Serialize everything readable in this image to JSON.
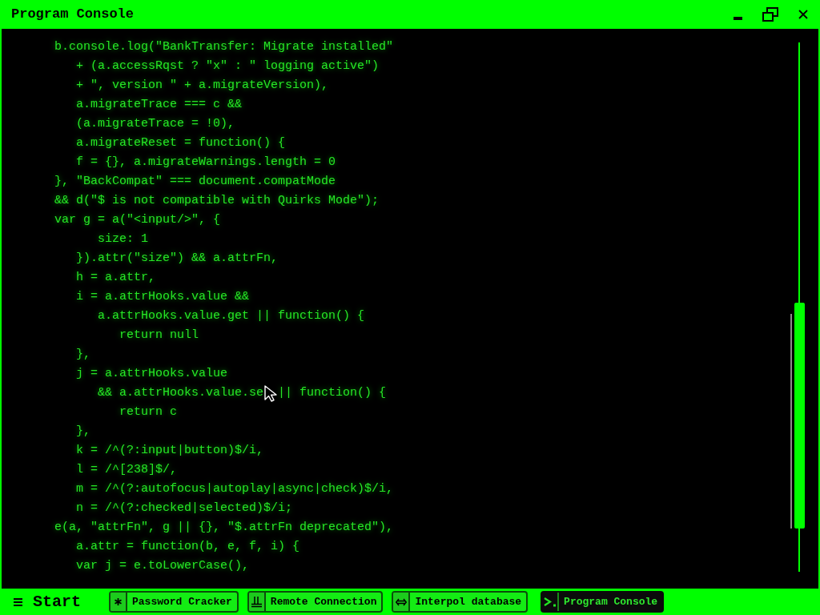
{
  "window": {
    "title": "Program Console",
    "controls": [
      {
        "kind": "minimize"
      },
      {
        "kind": "restore"
      },
      {
        "kind": "close"
      }
    ]
  },
  "console": {
    "lines": [
      {
        "text": "b.console.log(\"BankTransfer: Migrate installed\""
      },
      {
        "text": "   + (a.accessRqst ? \"x\" : \" logging active\")"
      },
      {
        "text": "   + \", version \" + a.migrateVersion),"
      },
      {
        "text": "   a.migrateTrace === c &&"
      },
      {
        "text": "   (a.migrateTrace = !0),"
      },
      {
        "text": "   a.migrateReset = function() {"
      },
      {
        "text": "   f = {}, a.migrateWarnings.length = 0"
      },
      {
        "text": "}, \"BackCompat\" === document.compatMode"
      },
      {
        "text": "&& d(\"$ is not compatible with Quirks Mode\");"
      },
      {
        "text": "var g = a(\"<input/>\", {"
      },
      {
        "text": "      size: 1"
      },
      {
        "text": "   }).attr(\"size\") && a.attrFn,"
      },
      {
        "text": "   h = a.attr,"
      },
      {
        "text": "   i = a.attrHooks.value &&"
      },
      {
        "text": "      a.attrHooks.value.get || function() {"
      },
      {
        "text": "         return null"
      },
      {
        "text": "   },"
      },
      {
        "text": "   j = a.attrHooks.value"
      },
      {
        "text": "      && a.attrHooks.value.se",
        "pointer": true,
        "after_pointer": "|| function() {"
      },
      {
        "text": "         return c"
      },
      {
        "text": "   },"
      },
      {
        "text": "   k = /^(?:input|button)$/i,"
      },
      {
        "text": "   l = /^[238]$/,"
      },
      {
        "text": "   m = /^(?:autofocus|autoplay|async|check)$/i,"
      },
      {
        "text": "   n = /^(?:checked|selected)$/i;"
      },
      {
        "text": "e(a, \"attrFn\", g || {}, \"$.attrFn deprecated\"),"
      },
      {
        "text": "   a.attr = function(b, e, f, i) {"
      },
      {
        "text": "   var j = e.toLowerCase(),"
      }
    ]
  },
  "taskbar": {
    "start": {
      "label": "Start"
    },
    "buttons": [
      {
        "label": "Password Cracker",
        "kind": "asterisk",
        "selected": false
      },
      {
        "label": "Remote Connection",
        "kind": "plug",
        "selected": false
      },
      {
        "label": "Interpol database",
        "kind": "double-arrow",
        "selected": false
      },
      {
        "label": "Program Console",
        "kind": "prompt",
        "selected": true
      }
    ]
  }
}
